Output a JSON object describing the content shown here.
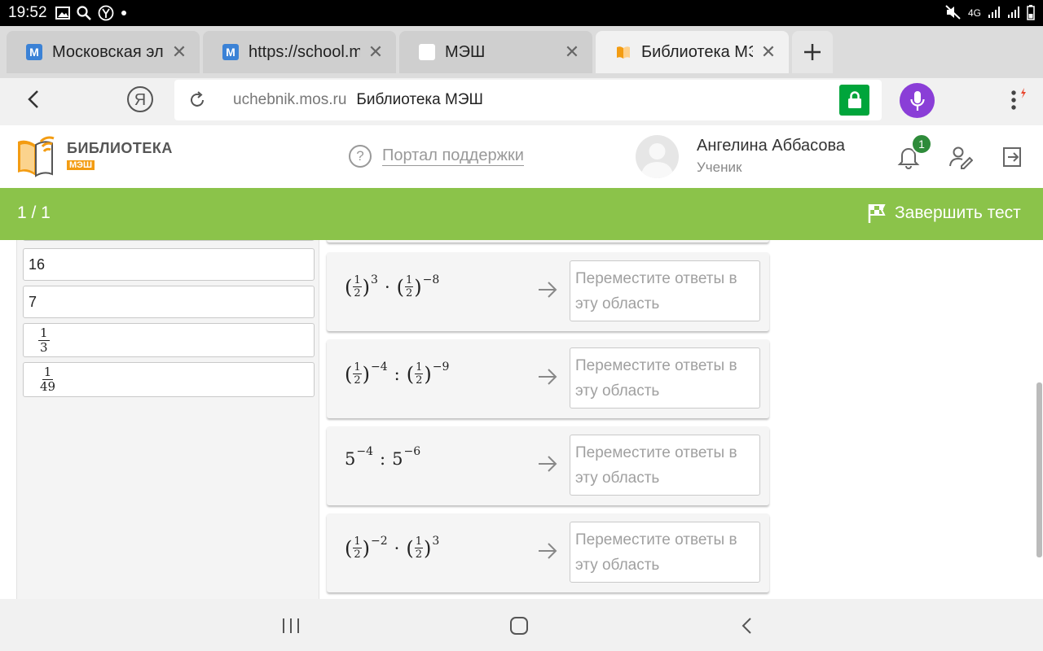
{
  "status_bar": {
    "time": "19:52",
    "network": "4G"
  },
  "tabs": [
    {
      "title": "Московская электронная школа",
      "favicon": "mesh-m-icon",
      "favicon_color": "#3b82d6"
    },
    {
      "title": "https://school.mos.ru",
      "favicon": "mesh-m-icon",
      "favicon_color": "#3b82d6"
    },
    {
      "title": "МЭШ",
      "favicon": "blank-page-icon",
      "favicon_color": "#ffffff"
    },
    {
      "title": "Библиотека МЭШ",
      "favicon": "book-icon",
      "favicon_color": "#f39c12"
    }
  ],
  "address_bar": {
    "domain": "uchebnik.mos.ru",
    "page_title": "Библиотека МЭШ"
  },
  "site_header": {
    "logo_line1": "БИБЛИОТЕКА",
    "logo_line2": "МЭШ",
    "support_link": "Портал поддержки",
    "user_name": "Ангелина Аббасова",
    "user_role": "Ученик",
    "notification_count": "1"
  },
  "test_bar": {
    "counter": "1 / 1",
    "finish_label": "Завершить тест",
    "color": "#8bc34a"
  },
  "answers": [
    {
      "text": "16"
    },
    {
      "text": "7"
    },
    {
      "numerator": "1",
      "denominator": "3"
    },
    {
      "numerator": "1",
      "denominator": "49"
    }
  ],
  "drop_placeholder": "Переместите ответы в эту область",
  "expressions": [
    {
      "label": "(1/2)^3 · (1/2)^-8",
      "exp1": "3",
      "op": "·",
      "exp2": "−8",
      "n": "1",
      "d": "2"
    },
    {
      "label": "(1/2)^-4 : (1/2)^-9",
      "exp1": "−4",
      "op": ":",
      "exp2": "−9",
      "n": "1",
      "d": "2"
    },
    {
      "label": "5^-4 : 5^-6",
      "base": "5",
      "exp1": "−4",
      "op": ":",
      "exp2": "−6"
    },
    {
      "label": "(1/2)^-2 · (1/2)^3",
      "exp1": "−2",
      "op": "·",
      "exp2": "3",
      "n": "1",
      "d": "2"
    }
  ]
}
